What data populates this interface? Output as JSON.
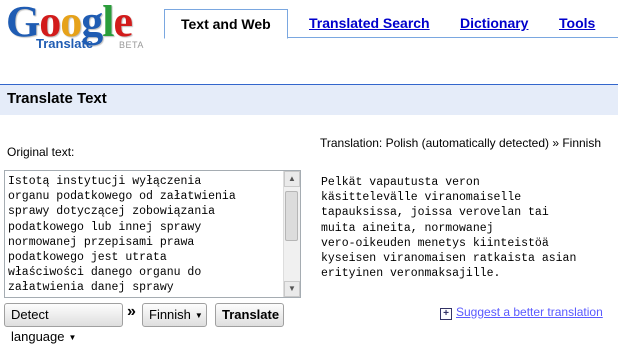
{
  "logo": {
    "word": [
      "G",
      "o",
      "o",
      "g",
      "l",
      "e"
    ],
    "word_colors": [
      "#1f5cb3",
      "#d21b1b",
      "#e6a21a",
      "#1f5cb3",
      "#2a9d3a",
      "#d21b1b"
    ],
    "sub": "Translate",
    "beta": "BETA"
  },
  "tabs": [
    {
      "label": "Text and Web",
      "active": true
    },
    {
      "label": "Translated Search",
      "active": false
    },
    {
      "label": "Dictionary",
      "active": false
    },
    {
      "label": "Tools",
      "active": false
    }
  ],
  "section_title": "Translate Text",
  "original": {
    "label": "Original text:",
    "text": "Istotą instytucji wyłączenia\norganu podatkowego od załatwienia\nsprawy dotyczącej zobowiązania\npodatkowego lub innej sprawy\nnormowanej przepisami prawa\npodatkowego jest utrata\nwłaściwości danego organu do\nzałatwienia danej sprawy"
  },
  "controls": {
    "source_lang": "Detect language",
    "arrow": "»",
    "target_lang": "Finnish",
    "translate": "Translate"
  },
  "translation": {
    "label": "Translation: Polish (automatically detected) » Finnish",
    "text": "Pelkät vapautusta veron\nkäsittelevälle viranomaiselle\ntapauksissa, joissa verovelan tai\nmuita aineita, normowanej\nvero-oikeuden menetys kiinteistöä\nkyseisen viranomaisen ratkaista asian\nerityinen veronmaksajille."
  },
  "suggest": {
    "label": "Suggest a better translation"
  },
  "colors": {
    "link": "#0000cc",
    "section_bg": "#e5ecf9",
    "section_border": "#3366cc"
  }
}
